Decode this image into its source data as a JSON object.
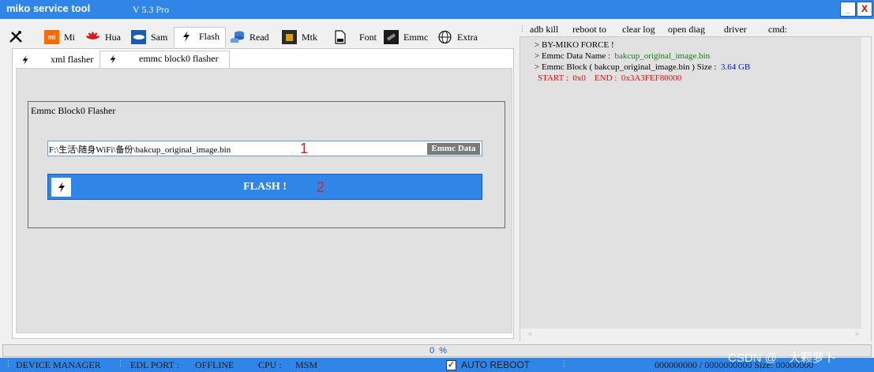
{
  "window": {
    "title": "miko service tool",
    "version": "V 5.3 Pro",
    "minimize_label": "_",
    "close_label": "X"
  },
  "tabs": [
    {
      "label": "",
      "icon": "tools-icon"
    },
    {
      "label": "Mi",
      "icon": "xiaomi-logo-icon"
    },
    {
      "label": "Hua",
      "icon": "huawei-logo-icon"
    },
    {
      "label": "Sam",
      "icon": "samsung-logo-icon"
    },
    {
      "label": "Flash",
      "icon": "lightning-icon",
      "active": true
    },
    {
      "label": "Read",
      "icon": "database-icon"
    },
    {
      "label": "Mtk",
      "icon": "chip-icon"
    },
    {
      "label": "Font",
      "icon": "ttf-file-icon"
    },
    {
      "label": "Emmc",
      "icon": "emmc-chip-icon"
    },
    {
      "label": "Extra",
      "icon": "globe-icon"
    }
  ],
  "subtabs": [
    {
      "label": "xml flasher",
      "icon": "lightning-icon"
    },
    {
      "label": "emmc block0 flasher",
      "icon": "lightning-icon",
      "active": true
    }
  ],
  "emmc_block0": {
    "group_title": "Emmc Block0 Flasher",
    "file_path": "F:\\生活\\随身WiFi\\备份\\bakcup_original_image.bin",
    "emmc_data_button": "Emmc Data",
    "marker_1": "1",
    "flash_button": "FLASH !",
    "marker_2": "2"
  },
  "commands": [
    "adb kill",
    "reboot to",
    "clear log",
    "open diag",
    "driver",
    "cmd:"
  ],
  "log": {
    "line1": "> BY-MIKO FORCE !",
    "line2_label": "> Emmc Data Name  :",
    "line2_value": "bakcup_original_image.bin",
    "line3_label": "> Emmc Block ( bakcup_original_image.bin ) Size  :",
    "line3_value": "3.64 GB",
    "line4_start_label": "START  :",
    "line4_start_value": "0x0",
    "line4_end_label": "END  :",
    "line4_end_value": "0x3A3FEF80000"
  },
  "progress": {
    "percent": 0,
    "text": "0  %"
  },
  "status": {
    "device_manager": "DEVICE MANAGER",
    "edl_port_label": "EDL PORT  :",
    "edl_port_value": "OFFLINE",
    "cpu_label": "CPU  :",
    "cpu_value": "MSM",
    "auto_reboot_label": "AUTO REBOOT",
    "auto_reboot_checked": true,
    "check_mark": "✓",
    "bytes": "000000000 / 0000000000 Size: 00000000"
  },
  "watermark": "CSDN @一大颗萝卜",
  "colors": {
    "accent": "#2f86e8",
    "log_green": "#1a7a1a",
    "log_blue": "#1010d8",
    "log_red": "#e01010",
    "marker_red": "#e01b1b"
  }
}
